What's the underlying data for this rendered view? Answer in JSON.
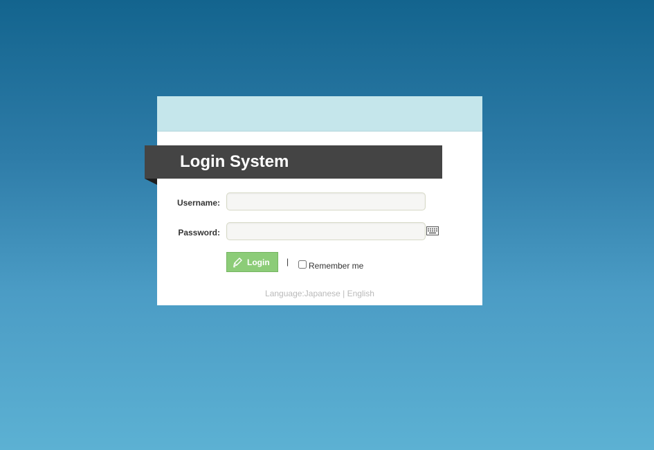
{
  "login_panel": {
    "title": "Login System",
    "username_label": "Username:",
    "username_value": "",
    "password_label": "Password:",
    "password_value": "",
    "keyboard_icon": "keyboard-icon",
    "login_button": {
      "label": "Login",
      "icon": "pencil-icon"
    },
    "separator": "|",
    "remember_label": "Remember me",
    "remember_checked": false,
    "language": {
      "prefix": "Language:",
      "options": [
        "Japanese",
        "English"
      ],
      "divider": " | "
    }
  },
  "colors": {
    "background_top": "#13648e",
    "background_bottom": "#5cb1d3",
    "header_band": "#c5e6eb",
    "ribbon": "#444444",
    "login_button": "#8ccc78"
  }
}
